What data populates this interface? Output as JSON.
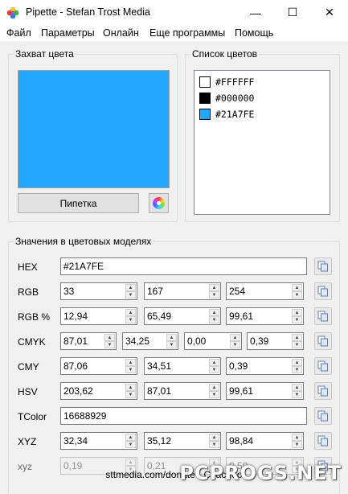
{
  "window": {
    "title": "Pipette - Stefan Trost Media",
    "buttons": {
      "minimize": "—",
      "maximize": "☐",
      "close": "✕"
    }
  },
  "menu": {
    "items": [
      "Файл",
      "Параметры",
      "Онлайн",
      "Еще программы",
      "Помощь"
    ]
  },
  "capture": {
    "title": "Захват цвета",
    "preview_color": "#21A7FE",
    "pipette_label": "Пипетка",
    "wheel_icon": "color-wheel-icon"
  },
  "color_list": {
    "title": "Список цветов",
    "items": [
      {
        "text": "#FFFFFF",
        "color": "#FFFFFF"
      },
      {
        "text": "#000000",
        "color": "#000000"
      },
      {
        "text": "#21A7FE",
        "color": "#21A7FE"
      }
    ]
  },
  "models": {
    "title": "Значения в цветовых моделях",
    "rows": [
      {
        "label": "HEX",
        "values": [
          "#21A7FE"
        ]
      },
      {
        "label": "RGB",
        "values": [
          "33",
          "167",
          "254"
        ]
      },
      {
        "label": "RGB %",
        "values": [
          "12,94",
          "65,49",
          "99,61"
        ]
      },
      {
        "label": "CMYK",
        "values": [
          "87,01",
          "34,25",
          "0,00",
          "0,39"
        ]
      },
      {
        "label": "CMY",
        "values": [
          "87,06",
          "34,51",
          "0,39"
        ]
      },
      {
        "label": "HSV",
        "values": [
          "203,62",
          "87,01",
          "99,61"
        ]
      },
      {
        "label": "TColor",
        "values": [
          "16688929"
        ]
      },
      {
        "label": "XYZ",
        "values": [
          "32,34",
          "35,12",
          "98,84"
        ]
      },
      {
        "label": "xyz",
        "values": [
          "0,19",
          "0,21",
          "0,59"
        ]
      }
    ],
    "copy_icon": "copy-icon"
  },
  "footer": {
    "link": "sttmedia.com/donate - Спасибо"
  },
  "watermark": {
    "text": "PCPROGS.NET"
  }
}
